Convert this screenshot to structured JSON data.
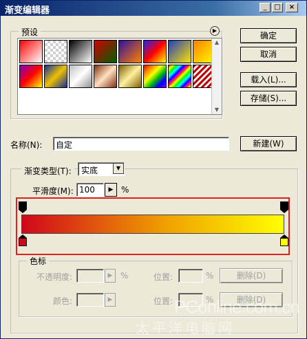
{
  "window": {
    "title": "渐变编辑器",
    "min": "_",
    "max": "□",
    "close": "×"
  },
  "buttons": {
    "ok": "确定",
    "cancel": "取消",
    "load": "载入(L)...",
    "save": "存储(S)...",
    "new": "新建(W)"
  },
  "presets": {
    "label": "预设"
  },
  "name": {
    "label": "名称(N):",
    "value": "自定"
  },
  "gradient_type": {
    "label": "渐变类型(T):",
    "value": "实底"
  },
  "smoothness": {
    "label": "平滑度(M):",
    "value": "100",
    "unit": "%"
  },
  "color_stops": {
    "label": "色标",
    "opacity_label": "不透明度:",
    "percent": "%",
    "location_label": "位置:",
    "delete_label": "删除(D)",
    "color_label": "颜色:"
  },
  "gradient": {
    "start_color": "#d0071b",
    "mid_color": "#f0a000",
    "end_color": "#ffff00"
  },
  "watermark": {
    "line1": "PConline.com.cn",
    "line2": "太平洋电脑网"
  }
}
